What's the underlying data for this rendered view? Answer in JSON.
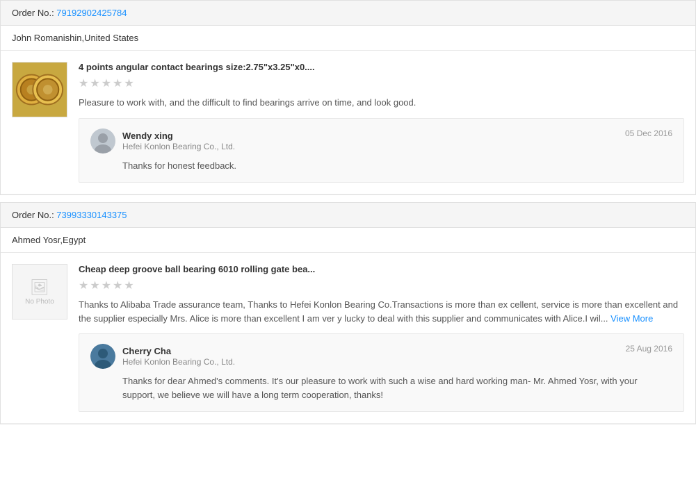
{
  "orders": [
    {
      "id": "order-1",
      "order_label": "Order No.:",
      "order_number": "79192902425784",
      "customer": "John Romanishin,United States",
      "reviews": [
        {
          "id": "review-1",
          "product_title": "4 points angular contact bearings size:2.75\"x3.25\"x0....",
          "stars": 0,
          "review_text": "Pleasure to work with, and the difficult to find bearings arrive on time, and look good.",
          "has_image": true,
          "replies": [
            {
              "author_name": "Wendy xing",
              "company": "Hefei Konlon Bearing Co., Ltd.",
              "date": "05 Dec 2016",
              "text": "Thanks for honest feedback.",
              "avatar_type": "wendy"
            }
          ]
        }
      ]
    },
    {
      "id": "order-2",
      "order_label": "Order No.:",
      "order_number": "73993330143375",
      "customer": "Ahmed Yosr,Egypt",
      "reviews": [
        {
          "id": "review-2",
          "product_title": "Cheap deep groove ball bearing 6010 rolling gate bea...",
          "stars": 0,
          "review_text": "Thanks to Alibaba Trade assurance team, Thanks to Hefei Konlon Bearing Co.Transactions is more than ex cellent, service is more than excellent and the supplier especially Mrs. Alice is more than excellent I am ver y lucky to deal with this supplier and communicates with Alice.I wil...",
          "view_more_label": "View More",
          "has_image": false,
          "replies": [
            {
              "author_name": "Cherry Cha",
              "company": "Hefei Konlon Bearing Co., Ltd.",
              "date": "25 Aug 2016",
              "text": "Thanks for dear Ahmed's comments. It's our pleasure to work with such a wise and hard working man- Mr. Ahmed Yosr, with your support, we believe we will have a long term cooperation, thanks!",
              "avatar_type": "cherry"
            }
          ]
        }
      ]
    }
  ]
}
